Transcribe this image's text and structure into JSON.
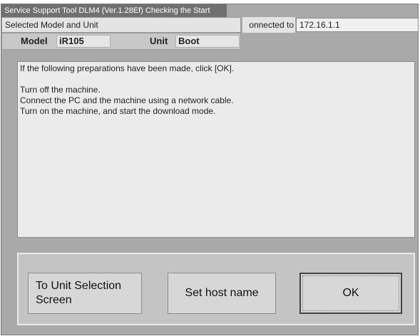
{
  "window": {
    "title": "Service Support Tool DLM4 (Ver.1.28Ef) Checking the Start"
  },
  "header": {
    "selected_label": "Selected Model and Unit",
    "connected_label": "Connected to",
    "connected_visible": "onnected to",
    "ip": "172.16.1.1"
  },
  "info": {
    "model_label": "Model",
    "model_value": "iR105",
    "unit_label": "Unit",
    "unit_value": "Boot"
  },
  "message": {
    "intro": "If the following preparations have been made, click [OK].",
    "steps": [
      "Turn off the machine.",
      "Connect the PC and the machine using a network cable.",
      "Turn on the machine, and start the download mode."
    ]
  },
  "buttons": {
    "unit_selection_line1": "To Unit Selection",
    "unit_selection_line2": "Screen",
    "set_host_name": "Set host name",
    "ok": "OK"
  }
}
